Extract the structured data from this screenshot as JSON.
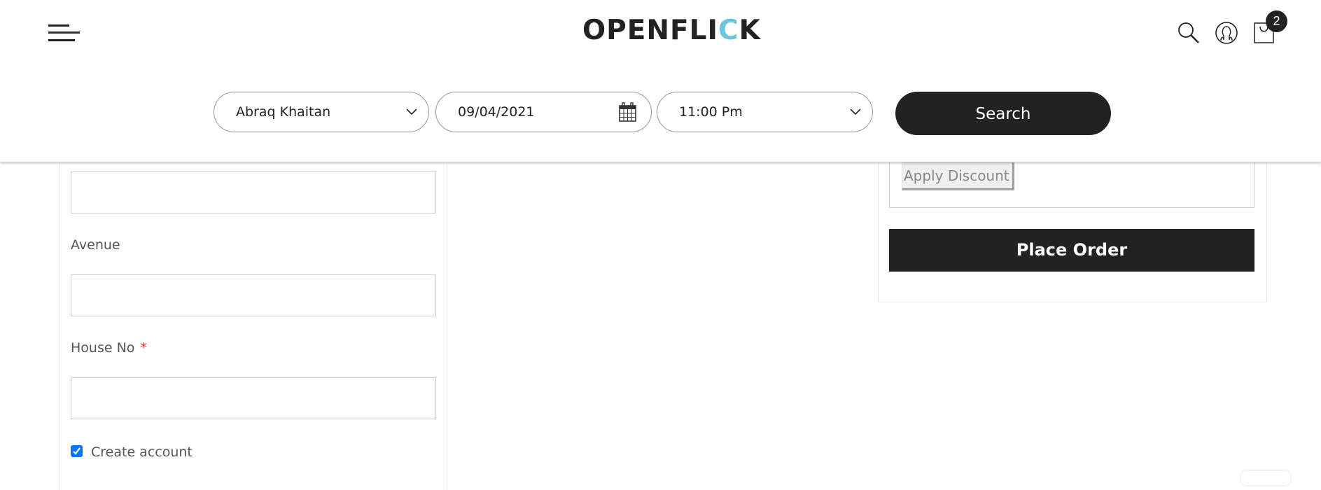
{
  "header": {
    "logo": {
      "text_main": "OPENFLI",
      "text_accent": "C",
      "text_end": "K"
    },
    "icons": [
      "menu-icon",
      "search-icon",
      "user-icon",
      "cart-icon"
    ],
    "cart_count": "2",
    "accent_color": "#6ac6da"
  },
  "search_bar": {
    "location": {
      "value": "Abraq Khaitan"
    },
    "date": {
      "value": "09/04/2021"
    },
    "time": {
      "value": "11:00 Pm"
    },
    "search_label": "Search"
  },
  "address_form": {
    "fields": [
      {
        "label": "",
        "value": ""
      },
      {
        "label": "Avenue",
        "value": ""
      },
      {
        "label": "House No",
        "required_mark": "*",
        "value": ""
      }
    ],
    "create_account": {
      "label": "Create account",
      "checked": true
    }
  },
  "order_summary": {
    "apply_discount_label": "Apply Discount",
    "place_order_label": "Place Order"
  }
}
